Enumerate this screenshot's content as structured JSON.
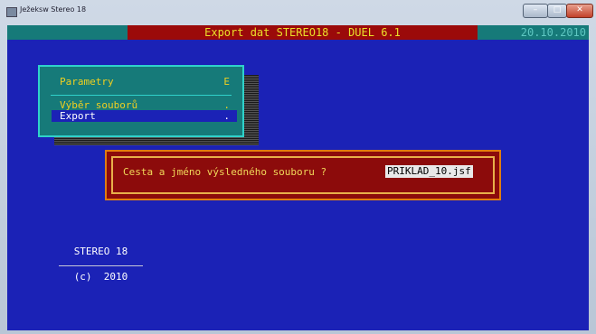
{
  "window": {
    "title": "Ježeksw Stereo 18"
  },
  "header": {
    "title": "Export dat STEREO18 - DUEL 6.1",
    "date": "20.10.2010"
  },
  "menu": {
    "items": [
      {
        "label": "Parametry",
        "key": "E"
      },
      {
        "label": "Výběr souborů",
        "key": "."
      },
      {
        "label": "Export",
        "key": ".",
        "selected": true
      }
    ]
  },
  "dialog": {
    "prompt": "Cesta a jméno výsledného souboru ?",
    "value": "PRIKLAD_10.jsf"
  },
  "copyright": {
    "product": "STEREO 18",
    "line": "(c)  2010"
  },
  "colors": {
    "background": "#1b22b6",
    "header_accent": "#9b0a0a",
    "teal": "#167a79",
    "yellow": "#eae02a"
  }
}
